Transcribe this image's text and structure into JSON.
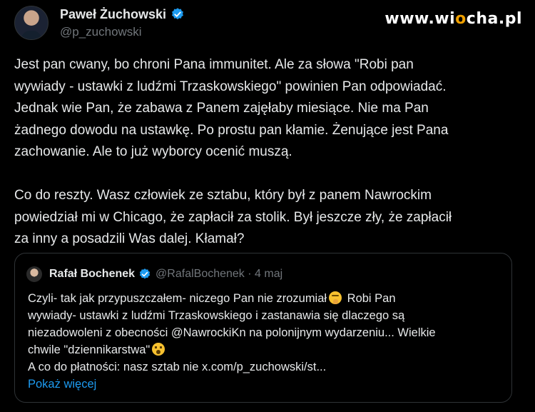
{
  "watermark": {
    "prefix": "www.wi",
    "o": "o",
    "suffix": "cha.pl"
  },
  "tweet": {
    "author_name": "Paweł Żuchowski",
    "author_handle": "@p_zuchowski",
    "text": "Jest pan cwany, bo chroni Pana immunitet. Ale za słowa \"Robi pan\nwywiady - ustawki z ludźmi Trzaskowskiego\" powinien Pan odpowiadać.\nJednak wie Pan, że zabawa z Panem zajęłaby miesiące. Nie ma Pan\nżadnego dowodu na ustawkę. Po prostu pan kłamie. Żenujące jest Pana\nzachowanie. Ale to już wyborcy ocenić muszą.\n\nCo do reszty. Wasz człowiek ze sztabu, który był z panem Nawrockim\npowiedział mi w Chicago, że zapłacił za stolik. Był jeszcze zły, że zapłacił\nza inny a posadzili Was dalej. Kłamał?"
  },
  "quote": {
    "author_name": "Rafał Bochenek",
    "meta": "@RafalBochenek · 4 maj",
    "line1": "Czyli- tak jak przypuszczałem- niczego Pan nie zrozumiał",
    "line1_after": " Robi Pan",
    "line2": "wywiady- ustawki z ludźmi Trzaskowskiego i zastanawia się dlaczego są",
    "line3": "niezadowoleni z obecności @NawrockiKn na polonijnym wydarzeniu... Wielkie",
    "line4": "chwile \"dziennikarstwa\"",
    "line5": "A co do płatności: nasz sztab nie x.com/p_zuchowski/st...",
    "show_more": "Pokaż więcej"
  },
  "icons": {
    "verified": "verified-badge-icon",
    "emoji_1": "shushing-face-emoji",
    "emoji_2": "astonished-face-emoji"
  },
  "colors": {
    "background": "#000000",
    "text": "#e7e9ea",
    "muted": "#71767b",
    "link": "#1d9bf0",
    "verified": "#1d9bf0"
  }
}
